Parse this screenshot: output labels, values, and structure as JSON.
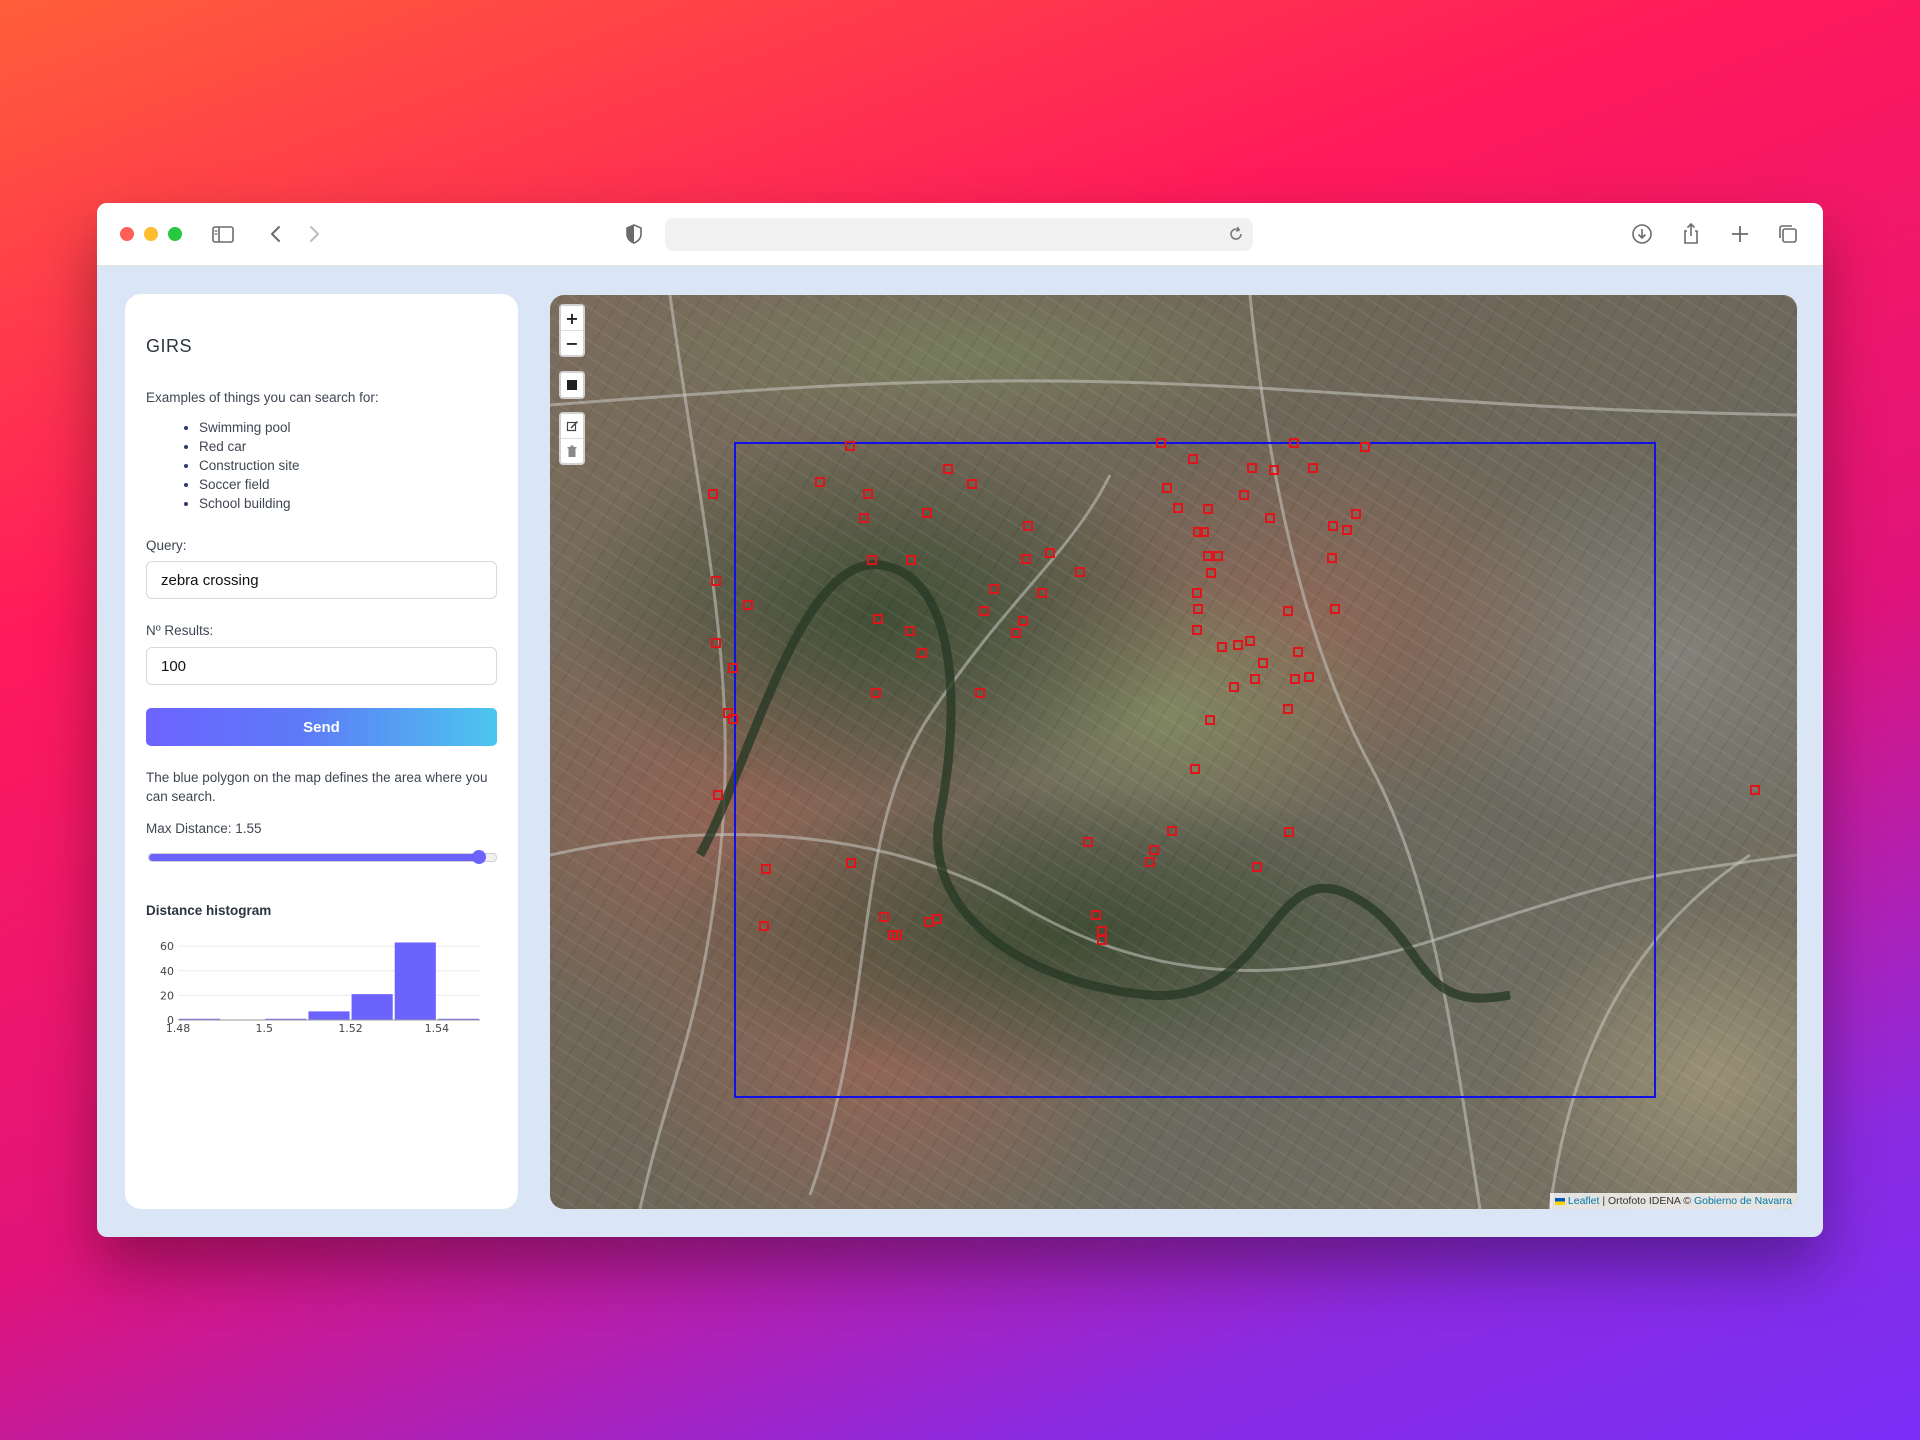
{
  "app": {
    "title": "GIRS",
    "intro": "Examples of things you can search for:",
    "examples": [
      "Swimming pool",
      "Red car",
      "Construction site",
      "Soccer field",
      "School building"
    ]
  },
  "form": {
    "query_label": "Query:",
    "query_value": "zebra crossing",
    "results_label": "Nº Results:",
    "results_value": "100",
    "send_label": "Send"
  },
  "note": "The blue polygon on the map defines the area where you can search.",
  "slider": {
    "label": "Max Distance: 1.55",
    "fraction": 0.95
  },
  "histogram": {
    "title": "Distance histogram"
  },
  "chart_data": {
    "type": "bar",
    "title": "Distance histogram",
    "xlabel": "",
    "ylabel": "",
    "x_ticks": [
      "1.48",
      "1.5",
      "1.52",
      "1.54"
    ],
    "y_ticks": [
      "0",
      "20",
      "40",
      "60"
    ],
    "xlim": [
      1.48,
      1.55
    ],
    "ylim": [
      0,
      65
    ],
    "bins": [
      {
        "start": 1.48,
        "end": 1.49,
        "count": 1
      },
      {
        "start": 1.49,
        "end": 1.5,
        "count": 0
      },
      {
        "start": 1.5,
        "end": 1.51,
        "count": 1
      },
      {
        "start": 1.51,
        "end": 1.52,
        "count": 7
      },
      {
        "start": 1.52,
        "end": 1.53,
        "count": 21
      },
      {
        "start": 1.53,
        "end": 1.54,
        "count": 63
      },
      {
        "start": 1.54,
        "end": 1.55,
        "count": 1
      }
    ],
    "bar_color": "#6c63ff",
    "grid": true
  },
  "map": {
    "zoom_in": "+",
    "zoom_out": "−",
    "attribution_leaflet": "Leaflet",
    "attribution_sep": " | Ortofoto IDENA © ",
    "attribution_gov": "Gobierno de Navarra",
    "polygon_color": "#0000ff",
    "marker_color": "#e0141a"
  },
  "colors": {
    "accent": "#6c63ff",
    "button_gradient_end": "#4cc6ee"
  },
  "icons": [
    "sidebar-toggle-icon",
    "back-icon",
    "forward-icon",
    "shield-icon",
    "reload-icon",
    "download-icon",
    "share-icon",
    "new-tab-icon",
    "tabs-icon",
    "draw-rectangle-icon",
    "edit-icon",
    "trash-icon"
  ]
}
